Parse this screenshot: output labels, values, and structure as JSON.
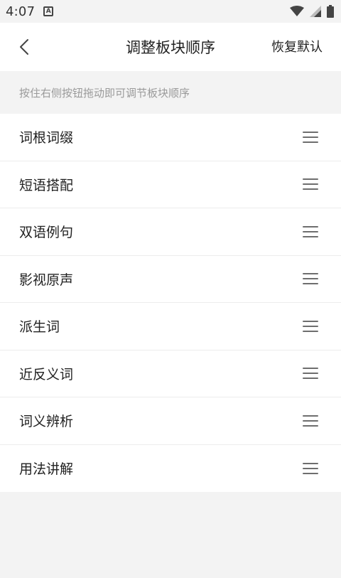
{
  "status_bar": {
    "time": "4:07",
    "notification_icon": "a-badge-icon",
    "icons": [
      "wifi-icon",
      "signal-icon",
      "battery-icon"
    ]
  },
  "header": {
    "title": "调整板块顺序",
    "reset_label": "恢复默认",
    "back_icon": "chevron-left-icon"
  },
  "hint": "按住右侧按钮拖动即可调节板块顺序",
  "sections": [
    {
      "label": "词根词缀"
    },
    {
      "label": "短语搭配"
    },
    {
      "label": "双语例句"
    },
    {
      "label": "影视原声"
    },
    {
      "label": "派生词"
    },
    {
      "label": "近反义词"
    },
    {
      "label": "词义辨析"
    },
    {
      "label": "用法讲解"
    }
  ],
  "colors": {
    "background": "#f3f3f3",
    "surface": "#ffffff",
    "hint_text": "#9a9a9a",
    "primary_text": "#222222",
    "handle": "#6e6e6e"
  }
}
